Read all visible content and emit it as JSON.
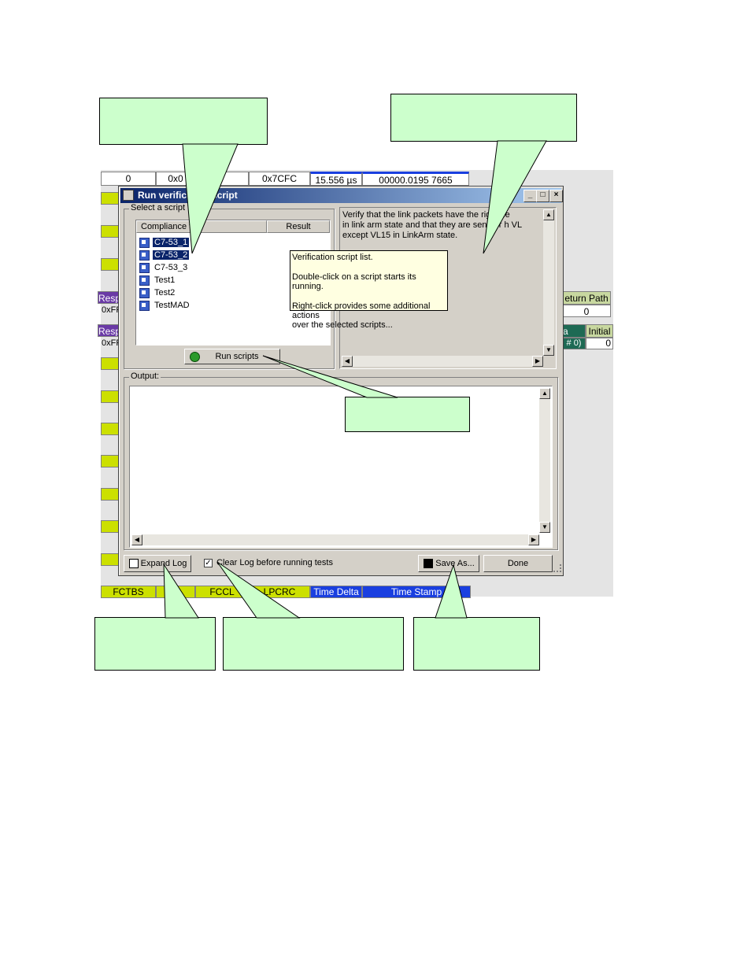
{
  "background_grid": {
    "top_row": [
      "0",
      "0x0",
      "0x7CFC",
      "15.556 µs",
      "00000.0195 7665"
    ],
    "left_labels": [
      "Resp",
      "0xFF",
      "Resp",
      "0xFF"
    ],
    "right_labels": {
      "return_path": "eturn Path",
      "return_value": "0",
      "a_label": "a",
      "initial_label": "Initial",
      "hash_label": "# 0)",
      "initial_value": "0"
    },
    "bottom_row": [
      "FCTBS",
      "FCCL",
      "LPCRC",
      "Time Delta",
      "Time Stamp"
    ]
  },
  "dialog": {
    "title": "Run verification script",
    "select_label": "Select a script to r",
    "columns": {
      "name": "Compliance tes",
      "result": "Result"
    },
    "scripts": [
      {
        "name": "C7-53_1",
        "selected": true
      },
      {
        "name": "C7-53_2",
        "selected": true
      },
      {
        "name": "C7-53_3",
        "selected": false
      },
      {
        "name": "Test1",
        "selected": false
      },
      {
        "name": "Test2",
        "selected": false
      },
      {
        "name": "TestMAD",
        "selected": false
      }
    ],
    "description": [
      "Verify that the link packets have the right      de",
      "in link arm state and that they are sent for     h VL",
      "except VL15 in LinkArm state."
    ],
    "run_button": "Run scripts",
    "output_label": "Output:",
    "expand_log": "Expand Log",
    "clear_log": "Clear Log before running tests",
    "clear_log_checked": true,
    "save_as": "Save As...",
    "done": "Done"
  },
  "tooltip": {
    "line1": "Verification script list.",
    "line2": "Double-click on a script starts its running.",
    "line3": "Right-click provides some additional actions",
    "line4": "over the selected scripts..."
  },
  "colors": {
    "callout": "#ccffcc",
    "title_start": "#0a246a",
    "grid_yellow": "#cce000",
    "grid_blue": "#1a3fe0"
  }
}
